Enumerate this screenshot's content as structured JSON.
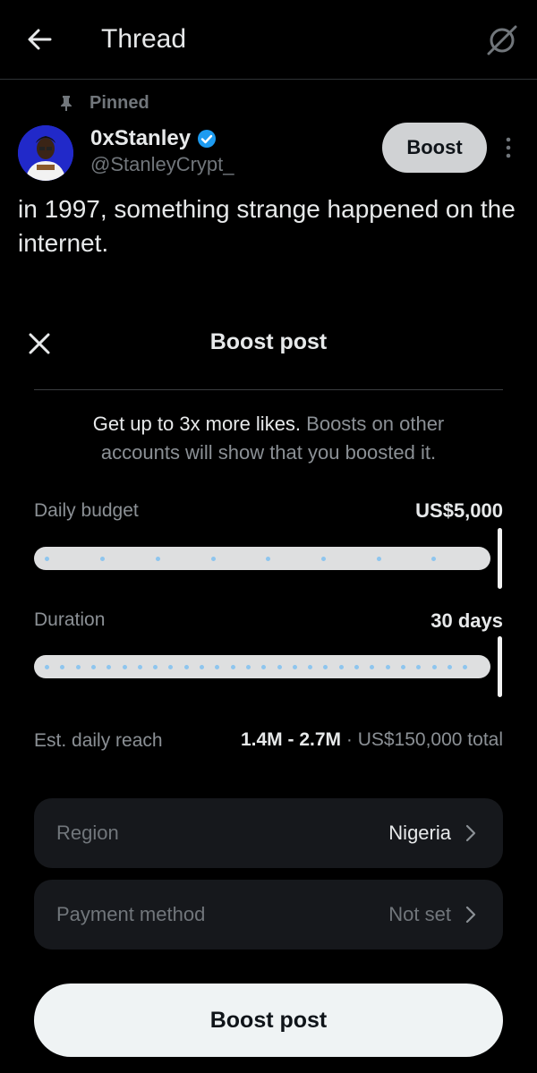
{
  "header": {
    "title": "Thread",
    "back_icon": "arrow-left-icon",
    "grok_icon": "grok-icon"
  },
  "post": {
    "pinned_label": "Pinned",
    "display_name": "0xStanley",
    "handle": "@StanleyCrypt_",
    "boost_label": "Boost",
    "text": "in 1997, something strange happened on the internet."
  },
  "sheet": {
    "title": "Boost post",
    "info_bold": "Get up to 3x more likes.",
    "info_rest": " Boosts on other accounts will show that you boosted it.",
    "budget": {
      "label": "Daily budget",
      "value": "US$5,000",
      "level": 1.0
    },
    "duration": {
      "label": "Duration",
      "value": "30 days",
      "level": 1.0
    },
    "reach": {
      "label": "Est. daily reach",
      "range": "1.4M - 2.7M",
      "separator": " · ",
      "total": "US$150,000 total"
    },
    "region": {
      "label": "Region",
      "value": "Nigeria"
    },
    "payment": {
      "label": "Payment method",
      "value": "Not set"
    },
    "cta_label": "Boost post"
  },
  "colors": {
    "background": "#000000",
    "accent_blue": "#1d9bf0",
    "secondary_text": "#71767b",
    "row_bg": "#16181c",
    "cta_bg": "#eff3f4"
  }
}
